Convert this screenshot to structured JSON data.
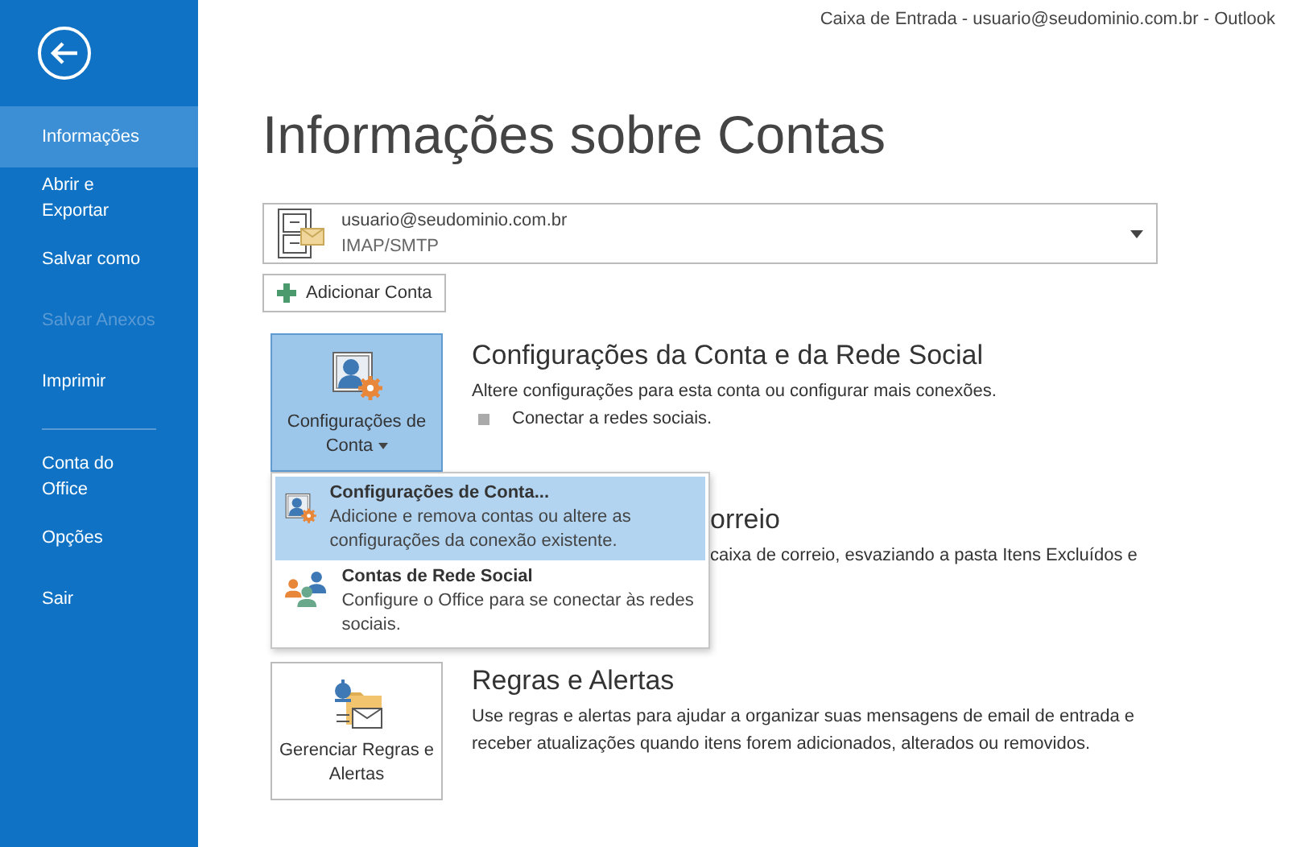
{
  "window": {
    "title": "Caixa de Entrada - usuario@seudominio.com.br - Outlook"
  },
  "sidebar": {
    "items": [
      {
        "label": "Informações",
        "selected": true,
        "disabled": false
      },
      {
        "label": "Abrir e Exportar",
        "selected": false,
        "disabled": false
      },
      {
        "label": "Salvar como",
        "selected": false,
        "disabled": false
      },
      {
        "label": "Salvar Anexos",
        "selected": false,
        "disabled": true
      },
      {
        "label": "Imprimir",
        "selected": false,
        "disabled": false
      },
      {
        "kind": "divider"
      },
      {
        "label": "Conta do Office",
        "selected": false,
        "disabled": false
      },
      {
        "label": "Opções",
        "selected": false,
        "disabled": false
      },
      {
        "label": "Sair",
        "selected": false,
        "disabled": false
      }
    ]
  },
  "heading": "Informações sobre Contas",
  "account": {
    "email": "usuario@seudominio.com.br",
    "type": "IMAP/SMTP"
  },
  "add_account_button": "Adicionar Conta",
  "sections": [
    {
      "kind": "full",
      "button": "Configurações de Conta",
      "selected": true,
      "dropdown": true,
      "title": "Configurações da Conta e da Rede Social",
      "description": "Altere configurações para esta conta ou configurar mais conexões.",
      "bullets": [
        "Conectar a redes sociais."
      ]
    },
    {
      "kind": "covered",
      "title": "orreio",
      "description": "caixa de correio, esvaziando a pasta Itens Excluídos e"
    },
    {
      "kind": "full",
      "button": "Gerenciar Regras e Alertas",
      "selected": false,
      "dropdown": false,
      "title": "Regras e Alertas",
      "description": "Use regras e alertas para ajudar a organizar suas mensagens de email de entrada e receber atualizações quando itens forem adicionados, alterados ou removidos."
    }
  ],
  "menu": {
    "items": [
      {
        "title": "Configurações de Conta...",
        "description": "Adicione e remova contas ou altere as configurações da conexão existente.",
        "selected": true
      },
      {
        "title": "Contas de Rede Social",
        "description": "Configure o Office para se conectar às redes sociais.",
        "selected": false
      }
    ]
  }
}
